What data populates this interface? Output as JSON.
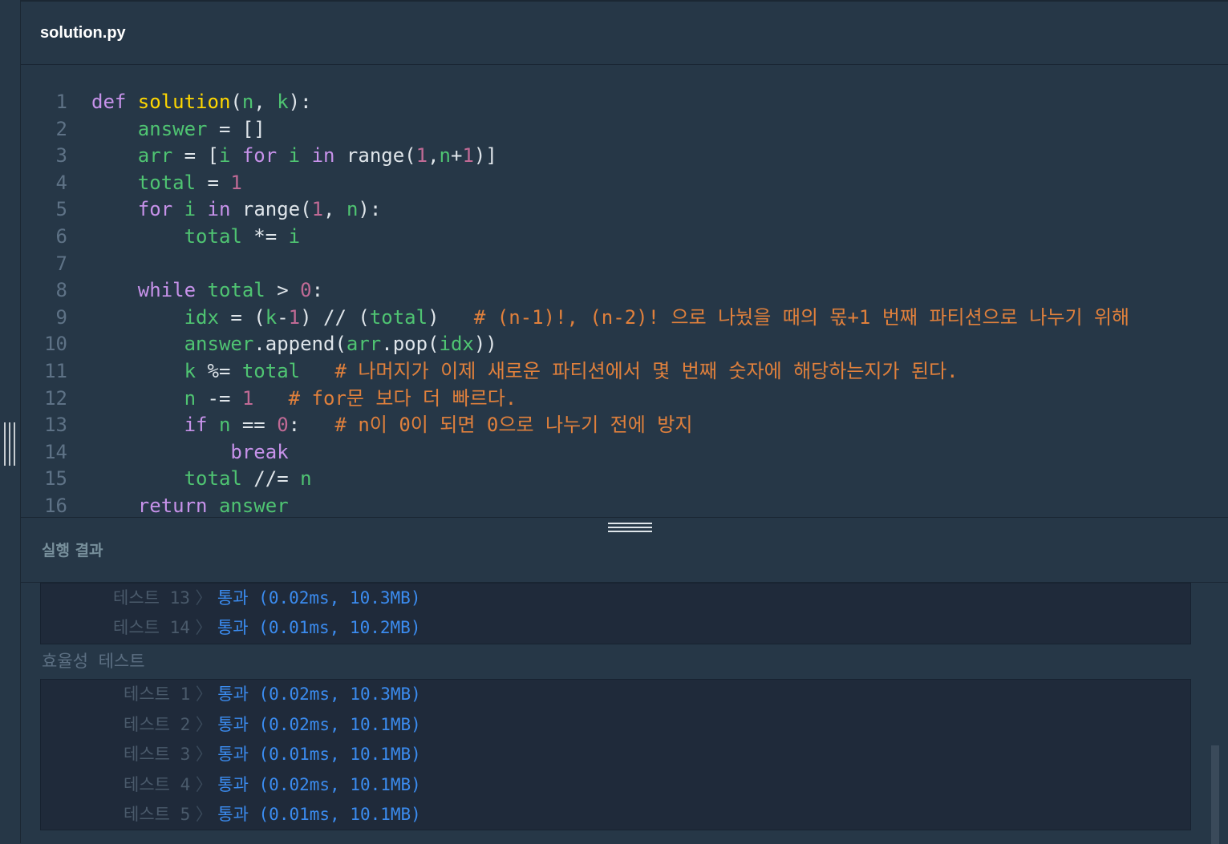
{
  "file": {
    "name": "solution.py"
  },
  "code": [
    {
      "n": "1",
      "tokens": [
        {
          "t": "def ",
          "c": "k"
        },
        {
          "t": "solution",
          "c": "f"
        },
        {
          "t": "(",
          "c": "txt"
        },
        {
          "t": "n",
          "c": "v"
        },
        {
          "t": ", ",
          "c": "txt"
        },
        {
          "t": "k",
          "c": "v"
        },
        {
          "t": "):",
          "c": "txt"
        }
      ]
    },
    {
      "n": "2",
      "tokens": [
        {
          "t": "    ",
          "c": "txt"
        },
        {
          "t": "answer",
          "c": "v"
        },
        {
          "t": " = []",
          "c": "txt"
        }
      ]
    },
    {
      "n": "3",
      "tokens": [
        {
          "t": "    ",
          "c": "txt"
        },
        {
          "t": "arr",
          "c": "v"
        },
        {
          "t": " = [",
          "c": "txt"
        },
        {
          "t": "i",
          "c": "v"
        },
        {
          "t": " ",
          "c": "txt"
        },
        {
          "t": "for",
          "c": "k"
        },
        {
          "t": " ",
          "c": "txt"
        },
        {
          "t": "i",
          "c": "v"
        },
        {
          "t": " ",
          "c": "txt"
        },
        {
          "t": "in",
          "c": "k"
        },
        {
          "t": " range(",
          "c": "txt"
        },
        {
          "t": "1",
          "c": "n"
        },
        {
          "t": ",",
          "c": "txt"
        },
        {
          "t": "n",
          "c": "v"
        },
        {
          "t": "+",
          "c": "txt"
        },
        {
          "t": "1",
          "c": "n"
        },
        {
          "t": ")]",
          "c": "txt"
        }
      ]
    },
    {
      "n": "4",
      "tokens": [
        {
          "t": "    ",
          "c": "txt"
        },
        {
          "t": "total",
          "c": "v"
        },
        {
          "t": " = ",
          "c": "txt"
        },
        {
          "t": "1",
          "c": "n"
        }
      ]
    },
    {
      "n": "5",
      "tokens": [
        {
          "t": "    ",
          "c": "txt"
        },
        {
          "t": "for",
          "c": "k"
        },
        {
          "t": " ",
          "c": "txt"
        },
        {
          "t": "i",
          "c": "v"
        },
        {
          "t": " ",
          "c": "txt"
        },
        {
          "t": "in",
          "c": "k"
        },
        {
          "t": " range(",
          "c": "txt"
        },
        {
          "t": "1",
          "c": "n"
        },
        {
          "t": ", ",
          "c": "txt"
        },
        {
          "t": "n",
          "c": "v"
        },
        {
          "t": "):",
          "c": "txt"
        }
      ]
    },
    {
      "n": "6",
      "tokens": [
        {
          "t": "        ",
          "c": "txt"
        },
        {
          "t": "total",
          "c": "v"
        },
        {
          "t": " *= ",
          "c": "txt"
        },
        {
          "t": "i",
          "c": "v"
        }
      ]
    },
    {
      "n": "7",
      "tokens": []
    },
    {
      "n": "8",
      "tokens": [
        {
          "t": "    ",
          "c": "txt"
        },
        {
          "t": "while",
          "c": "k"
        },
        {
          "t": " ",
          "c": "txt"
        },
        {
          "t": "total",
          "c": "v"
        },
        {
          "t": " > ",
          "c": "txt"
        },
        {
          "t": "0",
          "c": "n"
        },
        {
          "t": ":",
          "c": "txt"
        }
      ]
    },
    {
      "n": "9",
      "tokens": [
        {
          "t": "        ",
          "c": "txt"
        },
        {
          "t": "idx",
          "c": "v"
        },
        {
          "t": " = (",
          "c": "txt"
        },
        {
          "t": "k",
          "c": "v"
        },
        {
          "t": "-",
          "c": "txt"
        },
        {
          "t": "1",
          "c": "n"
        },
        {
          "t": ") // (",
          "c": "txt"
        },
        {
          "t": "total",
          "c": "v"
        },
        {
          "t": ")   ",
          "c": "txt"
        },
        {
          "t": "# (n-1)!, (n-2)! 으로 나눴을 때의 몫+1 번째 파티션으로 나누기 위해",
          "c": "c"
        }
      ]
    },
    {
      "n": "10",
      "tokens": [
        {
          "t": "        ",
          "c": "txt"
        },
        {
          "t": "answer",
          "c": "v"
        },
        {
          "t": ".append(",
          "c": "txt"
        },
        {
          "t": "arr",
          "c": "v"
        },
        {
          "t": ".pop(",
          "c": "txt"
        },
        {
          "t": "idx",
          "c": "v"
        },
        {
          "t": "))",
          "c": "txt"
        }
      ]
    },
    {
      "n": "11",
      "tokens": [
        {
          "t": "        ",
          "c": "txt"
        },
        {
          "t": "k",
          "c": "v"
        },
        {
          "t": " %= ",
          "c": "txt"
        },
        {
          "t": "total",
          "c": "v"
        },
        {
          "t": "   ",
          "c": "txt"
        },
        {
          "t": "# 나머지가 이제 새로운 파티션에서 몇 번째 숫자에 해당하는지가 된다.",
          "c": "c"
        }
      ]
    },
    {
      "n": "12",
      "tokens": [
        {
          "t": "        ",
          "c": "txt"
        },
        {
          "t": "n",
          "c": "v"
        },
        {
          "t": " -= ",
          "c": "txt"
        },
        {
          "t": "1",
          "c": "n"
        },
        {
          "t": "   ",
          "c": "txt"
        },
        {
          "t": "# for문 보다 더 빠르다.",
          "c": "c"
        }
      ]
    },
    {
      "n": "13",
      "tokens": [
        {
          "t": "        ",
          "c": "txt"
        },
        {
          "t": "if",
          "c": "k"
        },
        {
          "t": " ",
          "c": "txt"
        },
        {
          "t": "n",
          "c": "v"
        },
        {
          "t": " == ",
          "c": "txt"
        },
        {
          "t": "0",
          "c": "n"
        },
        {
          "t": ":   ",
          "c": "txt"
        },
        {
          "t": "# n이 0이 되면 0으로 나누기 전에 방지",
          "c": "c"
        }
      ]
    },
    {
      "n": "14",
      "tokens": [
        {
          "t": "            ",
          "c": "txt"
        },
        {
          "t": "break",
          "c": "k"
        }
      ]
    },
    {
      "n": "15",
      "tokens": [
        {
          "t": "        ",
          "c": "txt"
        },
        {
          "t": "total",
          "c": "v"
        },
        {
          "t": " //= ",
          "c": "txt"
        },
        {
          "t": "n",
          "c": "v"
        }
      ]
    },
    {
      "n": "16",
      "tokens": [
        {
          "t": "    ",
          "c": "txt"
        },
        {
          "t": "return",
          "c": "k"
        },
        {
          "t": " ",
          "c": "txt"
        },
        {
          "t": "answer",
          "c": "v"
        }
      ]
    }
  ],
  "result_title": "실행 결과",
  "accuracy_tests": [
    {
      "label": "테스트 13",
      "result": "통과 (0.02ms, 10.3MB)"
    },
    {
      "label": "테스트 14",
      "result": "통과 (0.01ms, 10.2MB)"
    }
  ],
  "efficiency_label": "효율성  테스트",
  "efficiency_tests": [
    {
      "label": "테스트 1",
      "result": "통과 (0.02ms, 10.3MB)"
    },
    {
      "label": "테스트 2",
      "result": "통과 (0.02ms, 10.1MB)"
    },
    {
      "label": "테스트 3",
      "result": "통과 (0.01ms, 10.1MB)"
    },
    {
      "label": "테스트 4",
      "result": "통과 (0.02ms, 10.1MB)"
    },
    {
      "label": "테스트 5",
      "result": "통과 (0.01ms, 10.1MB)"
    }
  ]
}
